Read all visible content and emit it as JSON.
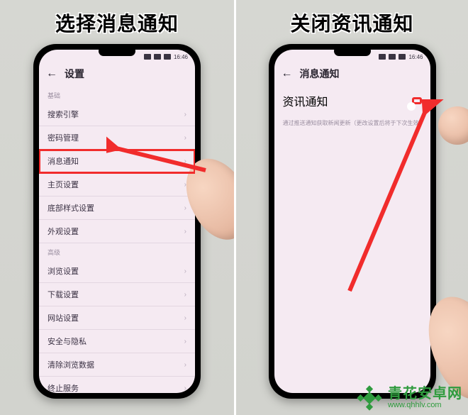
{
  "panels": {
    "left": {
      "title": "选择消息通知",
      "statusbar": {
        "time": "16:46"
      },
      "appbar": {
        "back": "←",
        "title": "设置"
      },
      "sections": {
        "basic_label": "基础",
        "advanced_label": "高级"
      },
      "rows": {
        "search_engine": "搜索引擎",
        "password_mgmt": "密码管理",
        "msg_notify": "消息通知",
        "homepage": "主页设置",
        "bottom_style": "底部样式设置",
        "appearance": "外观设置",
        "browse": "浏览设置",
        "download": "下载设置",
        "site": "网站设置",
        "privacy": "安全与隐私",
        "clear_data": "清除浏览数据",
        "stop_service": "终止服务"
      }
    },
    "right": {
      "title": "关闭资讯通知",
      "statusbar": {
        "time": "16:46"
      },
      "appbar": {
        "back": "←",
        "title": "消息通知"
      },
      "toggle_row": {
        "label": "资讯通知",
        "on": true
      },
      "desc": "通过推送通知获取新闻更新（更改设置后将于下次生效）"
    }
  },
  "watermark": {
    "brand": "青花安卓网",
    "url": "www.qhhlv.com"
  }
}
